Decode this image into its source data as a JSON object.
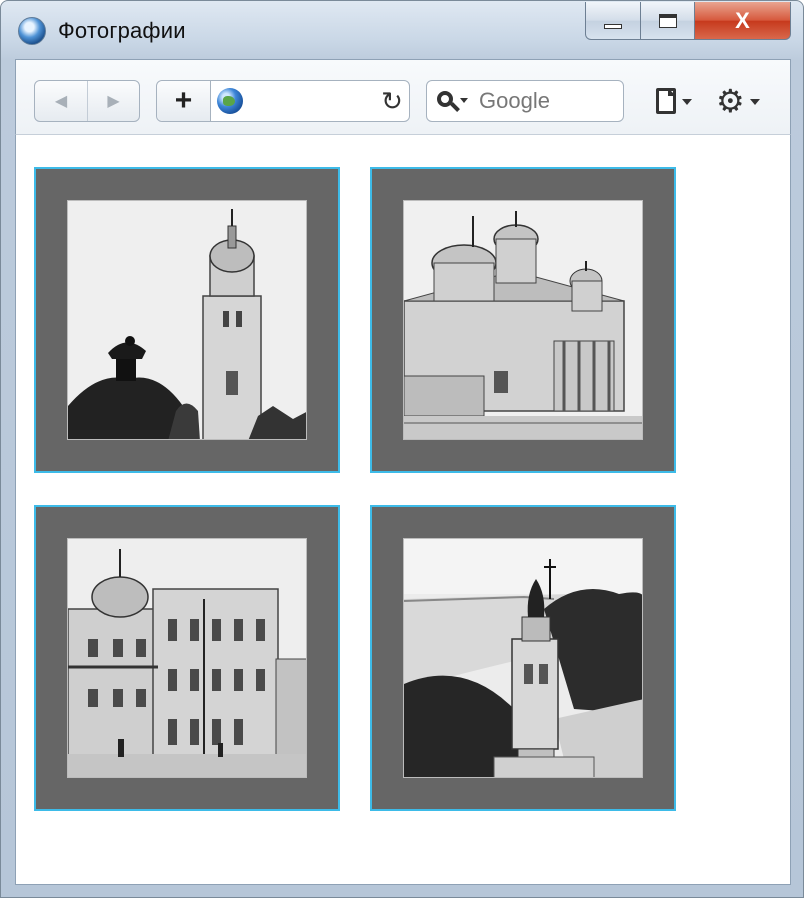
{
  "window": {
    "title": "Фотографии",
    "controls": {
      "minimize_icon": "minimize-icon",
      "maximize_icon": "maximize-icon",
      "close_label": "X"
    }
  },
  "toolbar": {
    "back_icon": "back-arrow-icon",
    "forward_icon": "forward-arrow-icon",
    "new_tab_label": "+",
    "address_value": "",
    "reload_icon": "reload-icon",
    "search_placeholder": "Google",
    "page_menu_icon": "page-icon",
    "tools_menu_icon": "gear-icon"
  },
  "gallery": {
    "border_color": "#3dbbe8",
    "tile_color": "#666666",
    "photos": [
      {
        "subject": "bell-tower-with-equestrian-monument"
      },
      {
        "subject": "domed-cathedral"
      },
      {
        "subject": "corner-building-with-dome"
      },
      {
        "subject": "monument-over-river"
      }
    ]
  }
}
